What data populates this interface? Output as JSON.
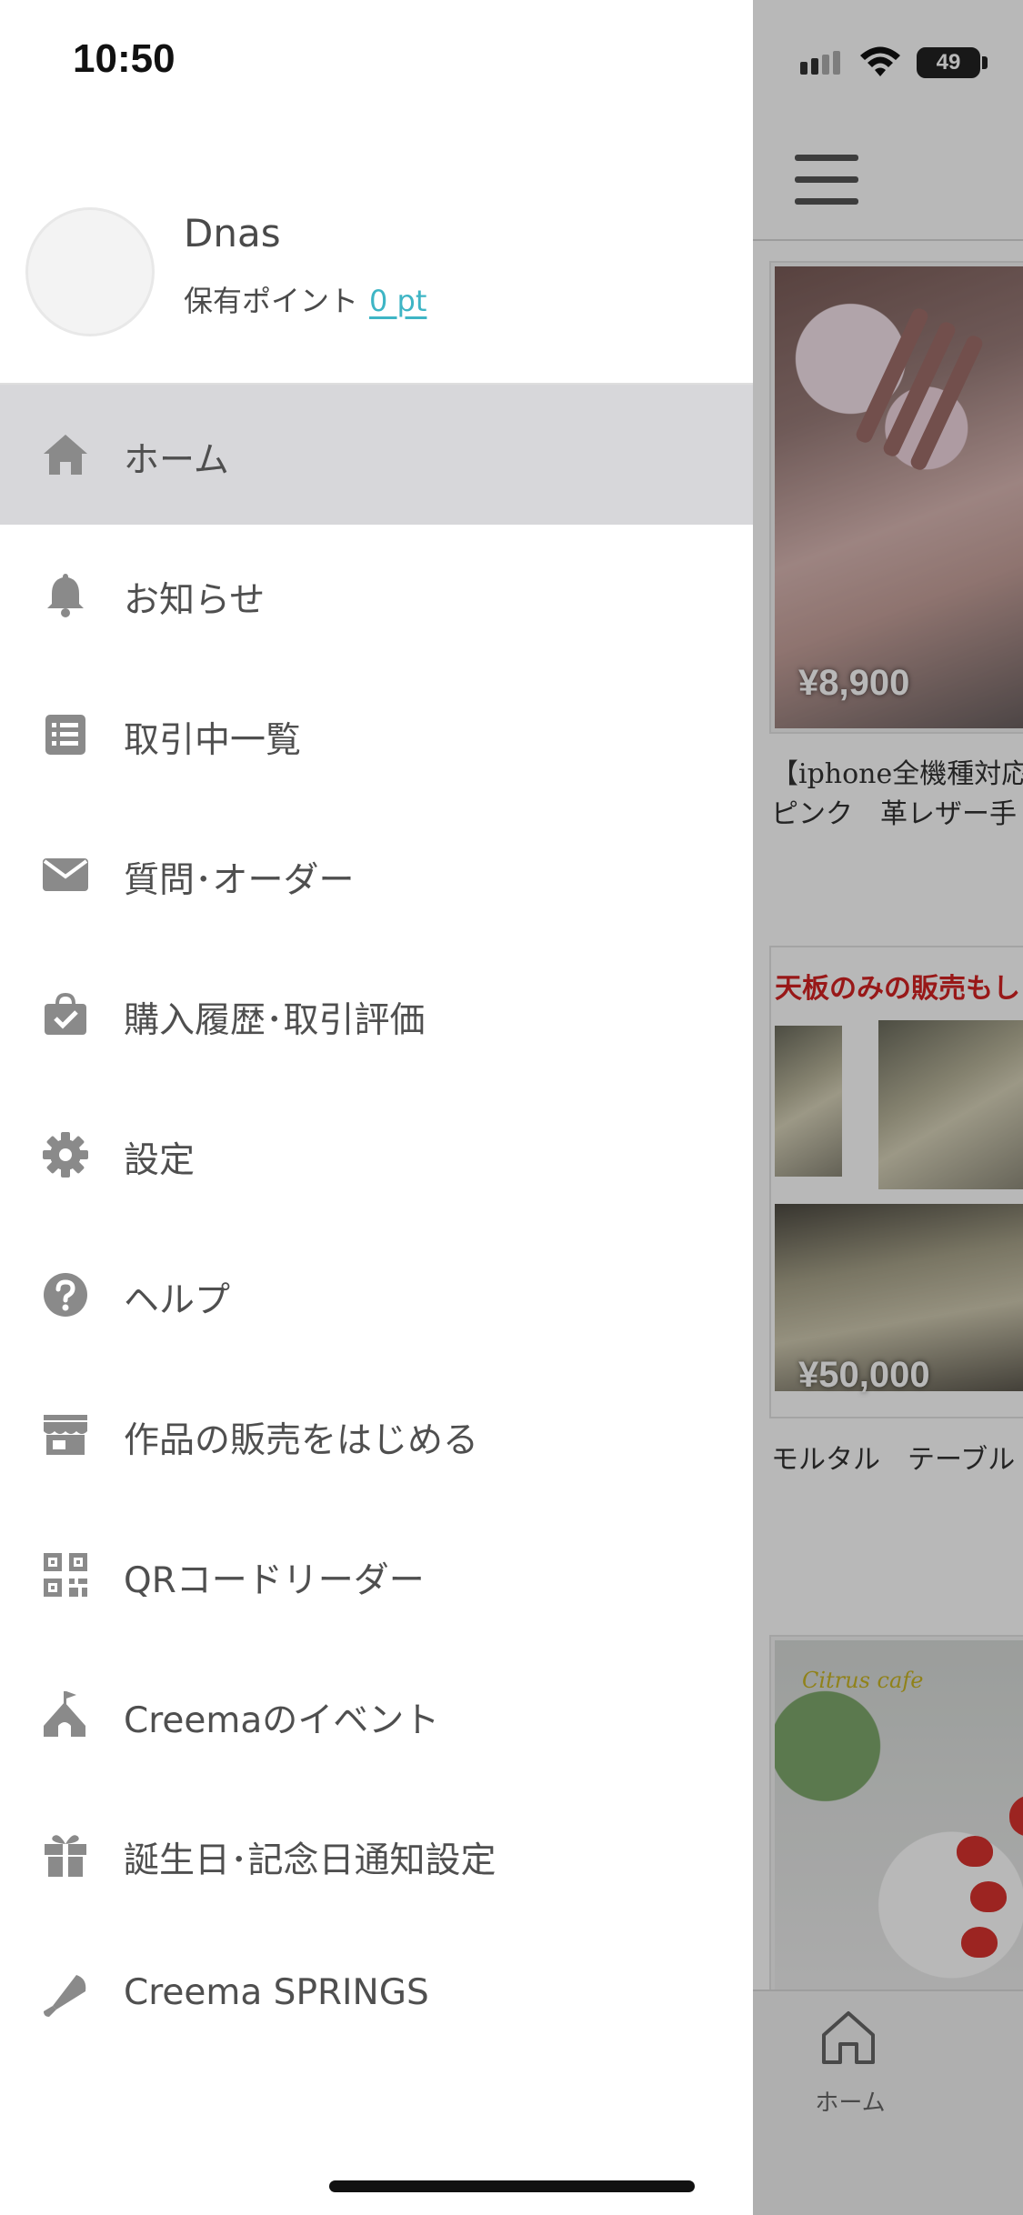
{
  "status_bar": {
    "time": "10:50",
    "battery": "49"
  },
  "profile": {
    "username": "Dnas",
    "points_label": "保有ポイント",
    "points_value": "0 pt"
  },
  "menu": [
    {
      "label": "ホーム",
      "icon": "home-icon",
      "active": true
    },
    {
      "label": "お知らせ",
      "icon": "bell-icon"
    },
    {
      "label": "取引中一覧",
      "icon": "list-icon"
    },
    {
      "label": "質問･オーダー",
      "icon": "mail-icon"
    },
    {
      "label": "購入履歴･取引評価",
      "icon": "shopping-bag-check-icon"
    },
    {
      "label": "設定",
      "icon": "gear-icon"
    },
    {
      "label": "ヘルプ",
      "icon": "help-icon"
    },
    {
      "label": "作品の販売をはじめる",
      "icon": "store-icon"
    },
    {
      "label": "QRコードリーダー",
      "icon": "qr-code-icon"
    },
    {
      "label": "Creemaのイベント",
      "icon": "tent-icon"
    },
    {
      "label": "誕生日･記念日通知設定",
      "icon": "gift-icon"
    },
    {
      "label": "Creema SPRINGS",
      "icon": "megaphone-icon"
    }
  ],
  "background_feed": {
    "items": [
      {
        "price": "¥8,900",
        "title_line1": "【iphone全機種対応",
        "title_line2": "ピンク　革レザー手"
      },
      {
        "banner": "天板のみの販売もし",
        "price": "¥50,000",
        "title_line1": "モルタル　テーブル"
      },
      {
        "photo_text": "Citrus cafe"
      }
    ],
    "bottom_tab_label": "ホーム"
  },
  "colors": {
    "accent": "#3eb5c5",
    "active_row": "#d7d7da",
    "icon_gray": "#8a8a8a"
  }
}
